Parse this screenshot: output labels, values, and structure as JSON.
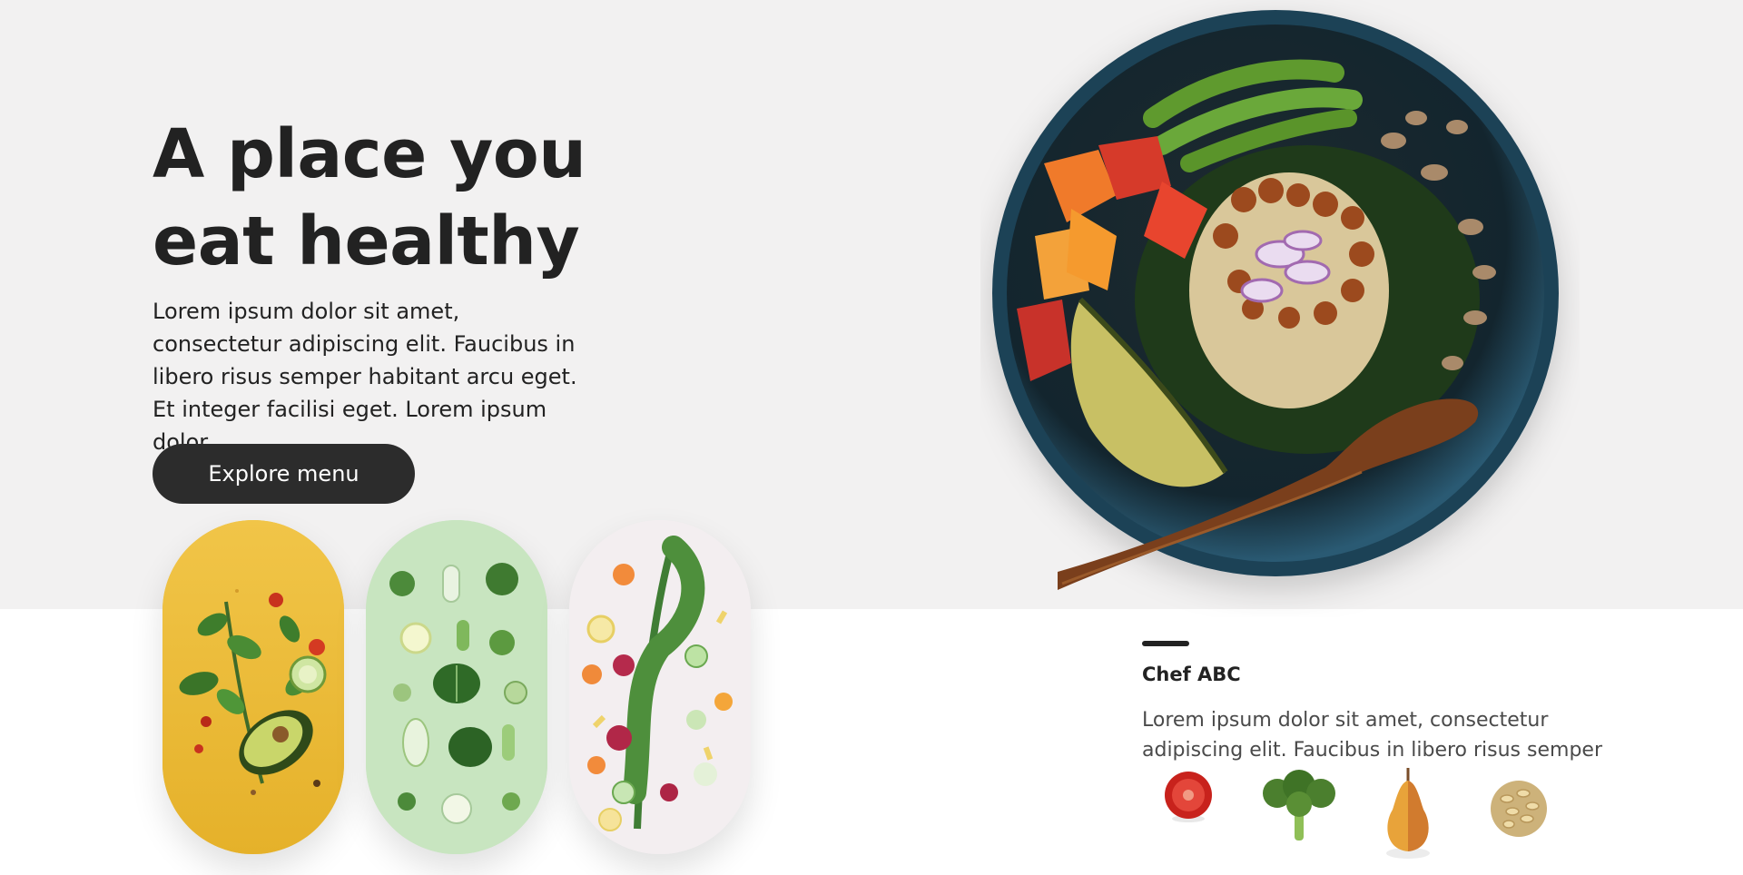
{
  "hero": {
    "title_line1": "A place you",
    "title_line2": "eat healthy",
    "description": "Lorem ipsum dolor sit amet, consectetur adipiscing elit. Faucibus in libero risus semper habitant arcu eget. Et integer facilisi eget. Lorem ipsum dolor.",
    "cta_label": "Explore menu"
  },
  "gallery": {
    "images": [
      {
        "name": "herbs-avocado-image",
        "background": "#eebd3a"
      },
      {
        "name": "green-vegetables-image",
        "background": "#c8e5c0"
      },
      {
        "name": "kale-vegetables-image",
        "background": "#f3eef0"
      }
    ]
  },
  "chef": {
    "name": "Chef ABC",
    "description": "Lorem ipsum dolor sit amet, consectetur adipiscing elit. Faucibus in libero risus semper"
  },
  "ingredients": [
    "tomato-icon",
    "broccoli-icon",
    "pear-icon",
    "nuts-icon"
  ],
  "colors": {
    "hero_background": "#f2f1f1",
    "button": "#2c2c2c",
    "text": "#222222",
    "bowl": "#1d4256"
  }
}
